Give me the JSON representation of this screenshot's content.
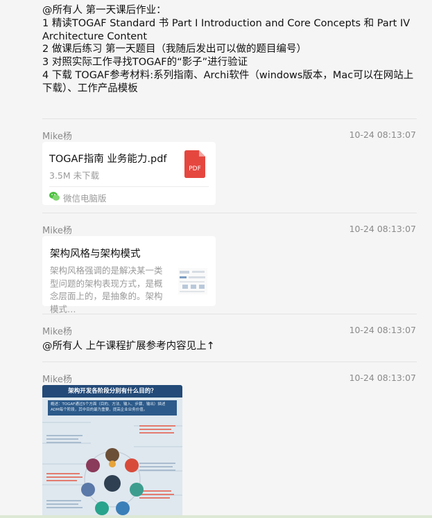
{
  "top_message": {
    "lines": [
      "@所有人 第一天课后作业：",
      "1 精读TOGAF Standard 书 Part I Introduction and Core Concepts 和 Part IV Architecture Content",
      "2 做课后练习 第一天题目（我随后发出可以做的题目编号）",
      "3 对照实际工作寻找TOGAF的“影子”进行验证",
      "4 下载 TOGAF参考材料:系列指南、Archi软件（windows版本，Mac可以在网站上下载）、工作产品模板"
    ]
  },
  "messages": [
    {
      "sender": "Mike杨",
      "time": "10-24 08:13:07",
      "file": {
        "name": "TOGAF指南 业务能力.pdf",
        "size": "3.5M 未下载",
        "icon": "pdf-icon",
        "icon_label": "PDF",
        "source": "微信电脑版",
        "source_icon": "wechat-icon"
      }
    },
    {
      "sender": "Mike杨",
      "time": "10-24 08:13:07",
      "link": {
        "title": "架构风格与架构模式",
        "description": "架构风格强调的是解决某一类型问题的架构表现方式，是概念层面上的，是抽象的。架构模式…"
      }
    },
    {
      "sender": "Mike杨",
      "time": "10-24 08:13:07",
      "text": "@所有人 上午课程扩展参考内容见上↑"
    },
    {
      "sender": "Mike杨",
      "time": "10-24 08:13:07",
      "image": {
        "title": "架构开发各阶段分别有什么目的？",
        "intro": "概述：TOGAF通过5个方面（目的、方法、输入、步骤、输出）描述ADM每个阶段，其中目的最为重要，提高企业业务价值。"
      }
    }
  ],
  "colors": {
    "background": "#f5f5f5",
    "meta_text": "#8a8a8a",
    "pdf_red": "#e5473f",
    "wechat_green": "#4bbf3f",
    "poster_blue": "#234a78"
  }
}
